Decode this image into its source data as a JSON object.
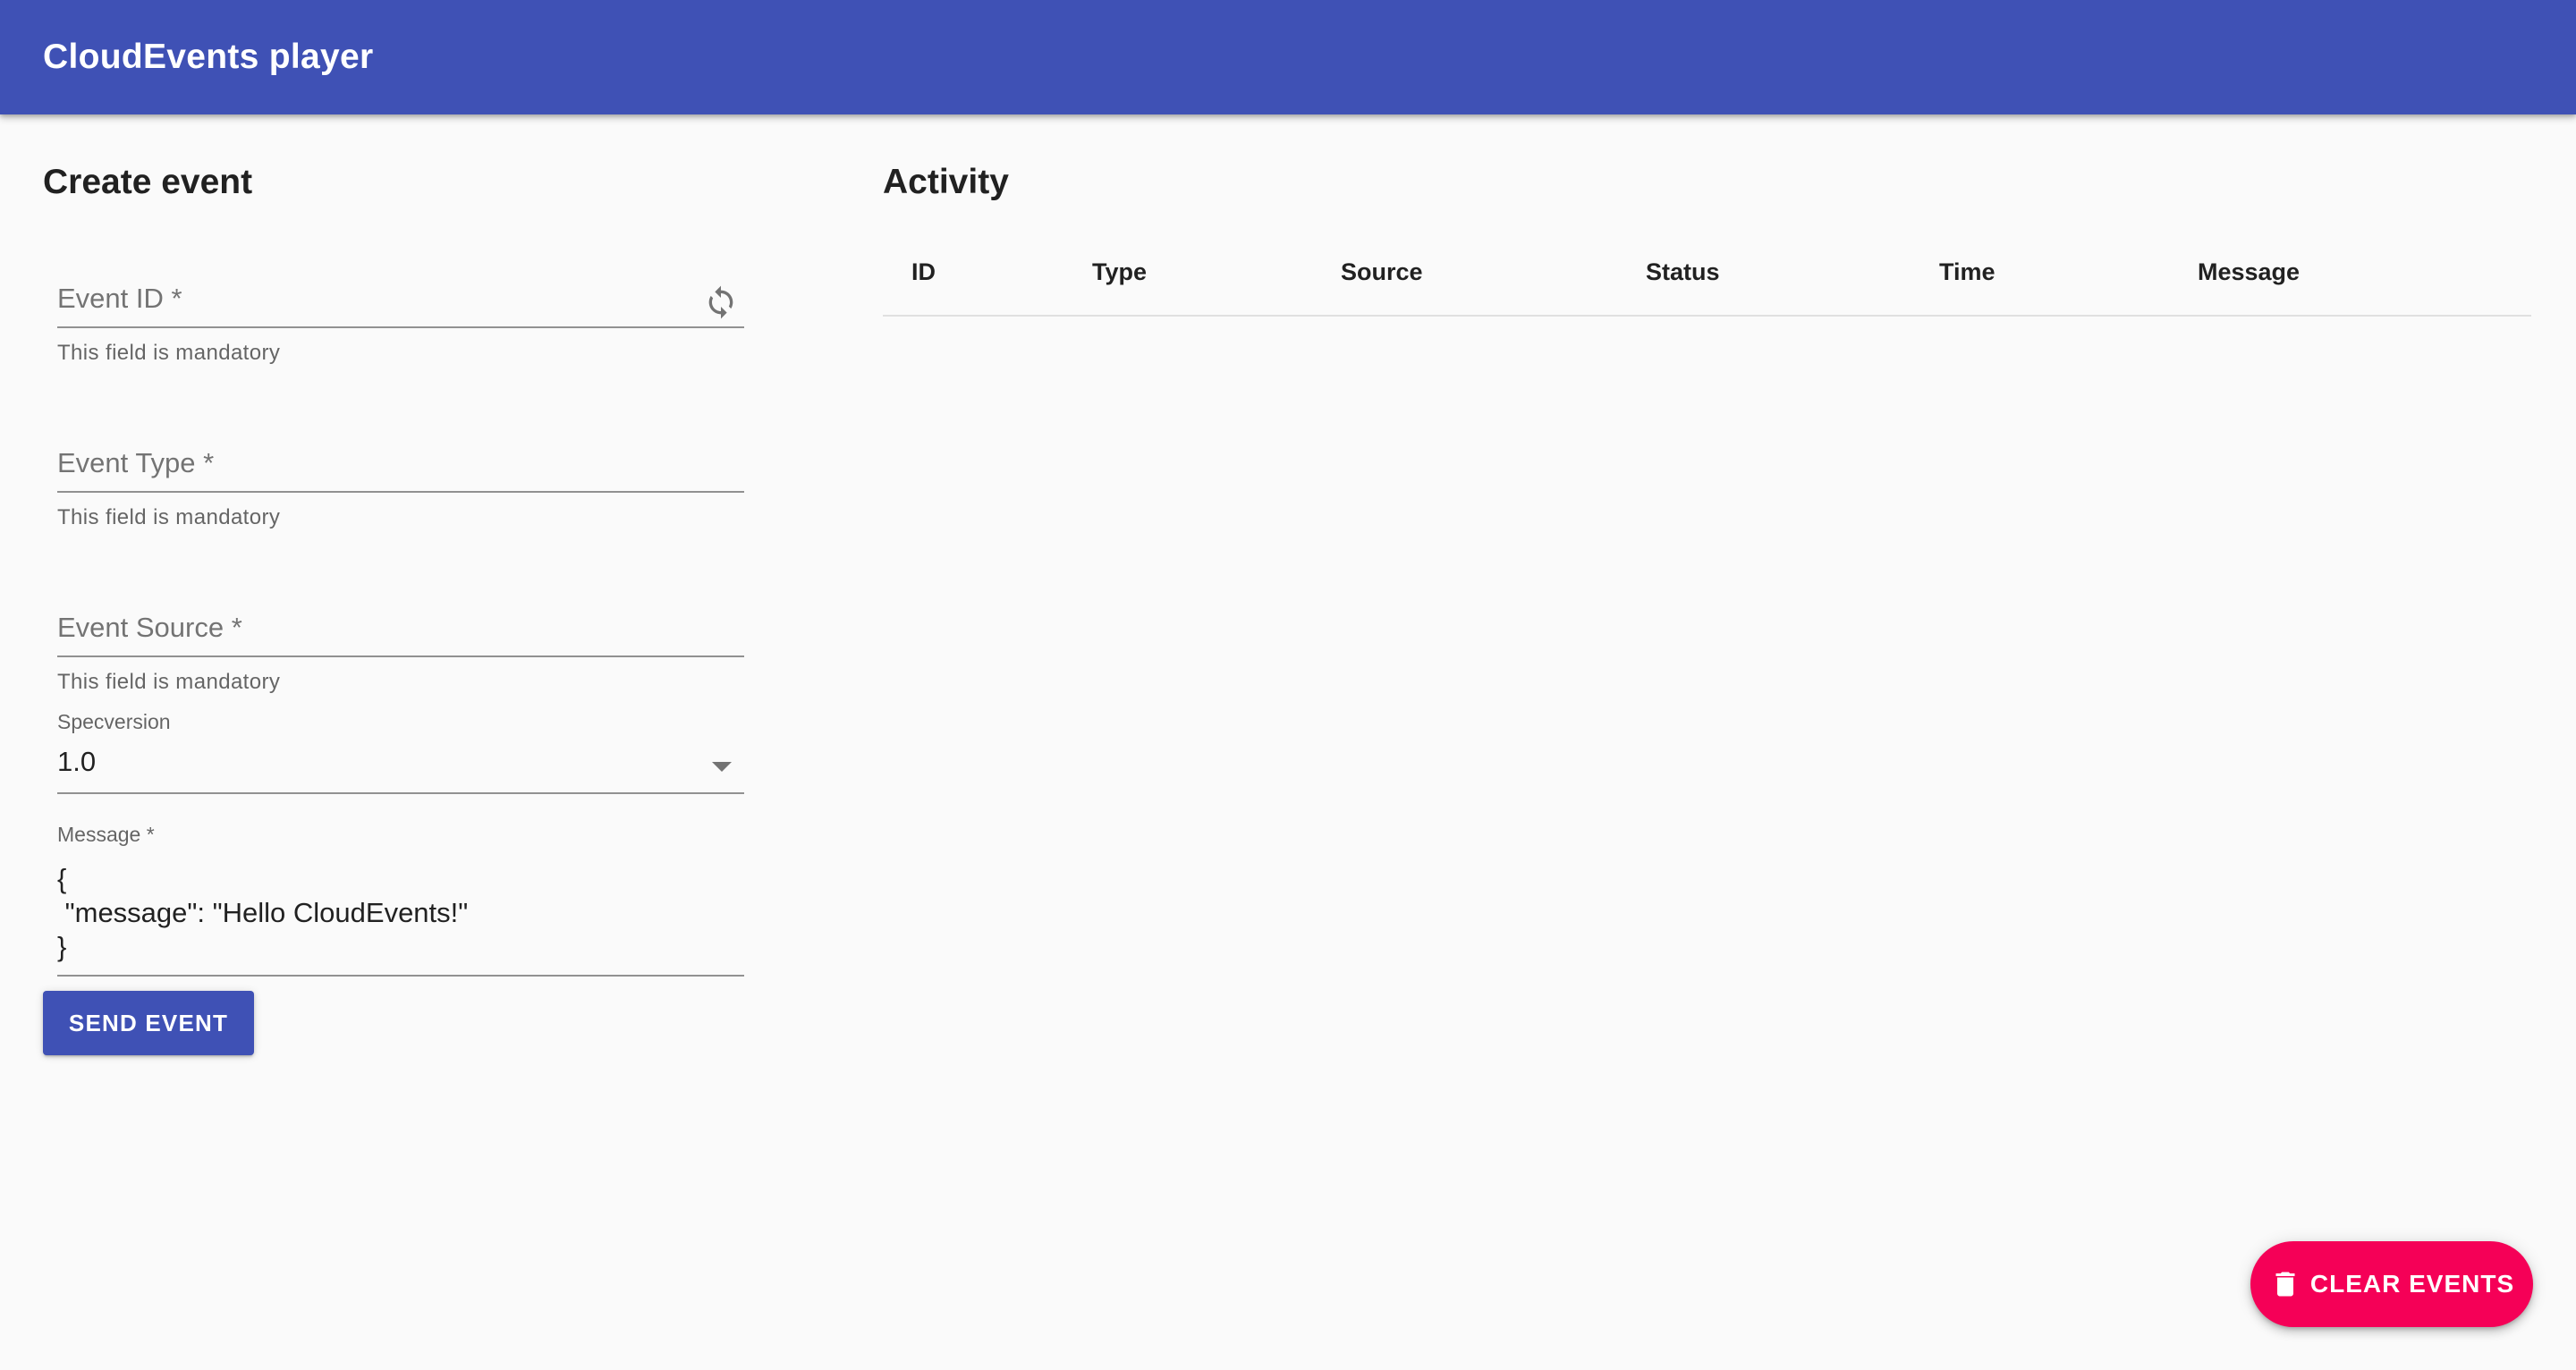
{
  "appbar": {
    "title": "CloudEvents player"
  },
  "create": {
    "title": "Create event",
    "event_id": {
      "label": "Event ID *",
      "helper": "This field is mandatory",
      "value": ""
    },
    "event_type": {
      "label": "Event Type *",
      "helper": "This field is mandatory",
      "value": ""
    },
    "event_source": {
      "label": "Event Source *",
      "helper": "This field is mandatory",
      "value": ""
    },
    "specversion": {
      "label": "Specversion",
      "value": "1.0"
    },
    "message": {
      "label": "Message *",
      "value": "{\n \"message\": \"Hello CloudEvents!\"\n}"
    },
    "send_label": "SEND EVENT"
  },
  "activity": {
    "title": "Activity",
    "columns": [
      "ID",
      "Type",
      "Source",
      "Status",
      "Time",
      "Message"
    ],
    "rows": []
  },
  "fab": {
    "label": "CLEAR EVENTS",
    "icon": "trash-icon"
  },
  "colors": {
    "primary": "#3f51b5",
    "secondary": "#f50057",
    "background": "#fafafa"
  }
}
